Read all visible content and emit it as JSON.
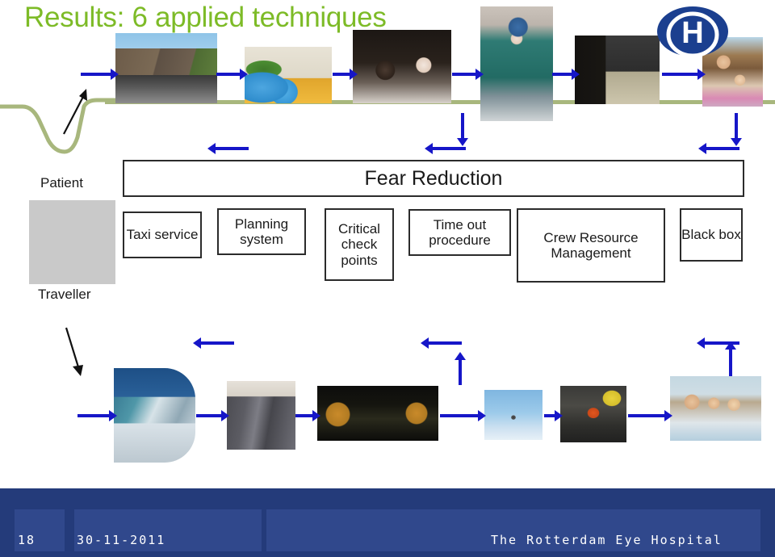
{
  "slide": {
    "title": "Results: 6 applied techniques",
    "title_color": "#7DBB27",
    "accent_blue": "#1616c8",
    "footer_blue": "#243b7a",
    "journey_line_green": "#A8B77D"
  },
  "roles": {
    "patient_label": "Patient",
    "traveller_label": "Traveller"
  },
  "fear_box": {
    "label": "Fear Reduction"
  },
  "techniques": [
    {
      "label": "Taxi service"
    },
    {
      "label": "Planning system"
    },
    {
      "label": "Critical check points"
    },
    {
      "label": "Time out procedure"
    },
    {
      "label": "Crew Resource Management"
    },
    {
      "label": "Black box"
    }
  ],
  "patient_journey_images": [
    {
      "name": "hospital-building-photo",
      "alt": "Hospital building exterior with cars"
    },
    {
      "name": "waiting-room-photo",
      "alt": "Hospital waiting room with blue chairs and plants"
    },
    {
      "name": "eye-examination-photo",
      "alt": "Clinician performing eye examination with slit lamp"
    },
    {
      "name": "surgery-photo",
      "alt": "Surgeon in operating theatre"
    },
    {
      "name": "monitor-wall-photo",
      "alt": "Room with wall of monitors"
    },
    {
      "name": "mother-and-child-photo",
      "alt": "Smiling mother hugging her daughter"
    }
  ],
  "traveller_journey_images": [
    {
      "name": "airport-terminal-photo",
      "alt": "Airport terminal with control tower and aircraft"
    },
    {
      "name": "aircraft-cabin-photo",
      "alt": "Aircraft cabin interior with seats"
    },
    {
      "name": "cockpit-photo",
      "alt": "Two pilots in aircraft cockpit"
    },
    {
      "name": "aircraft-in-flight-photo",
      "alt": "Airliner flying in blue sky"
    },
    {
      "name": "baggage-handling-photo",
      "alt": "Luggage in aircraft cargo hold"
    },
    {
      "name": "family-holiday-photo",
      "alt": "Family of three on holiday by the water"
    }
  ],
  "logo": {
    "name": "rotterdam-eye-hospital-logo",
    "letter": "H",
    "color": "#1b3f8f"
  },
  "footer": {
    "slide_number": "18",
    "date": "30-11-2011",
    "organisation": "The Rotterdam Eye Hospital"
  }
}
